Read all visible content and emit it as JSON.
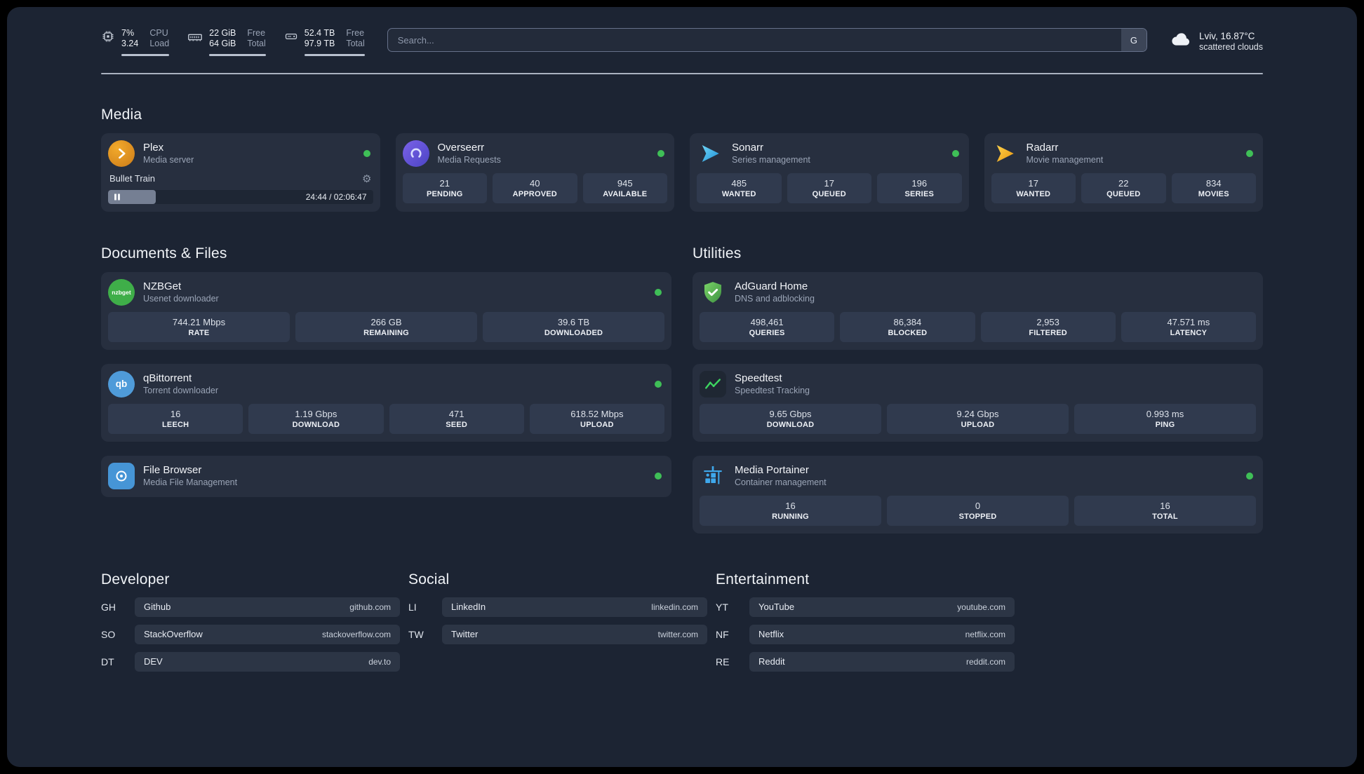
{
  "header": {
    "cpu": {
      "line1": "7%",
      "line2": "3.24",
      "label1": "CPU",
      "label2": "Load"
    },
    "ram": {
      "line1": "22 GiB",
      "line2": "64 GiB",
      "label1": "Free",
      "label2": "Total"
    },
    "disk": {
      "line1": "52.4 TB",
      "line2": "97.9 TB",
      "label1": "Free",
      "label2": "Total"
    },
    "search": {
      "placeholder": "Search...",
      "engine": "G"
    },
    "weather": {
      "location": "Lviv, 16.87°C",
      "condition": "scattered clouds"
    }
  },
  "sections": {
    "media": "Media",
    "documents": "Documents & Files",
    "utilities": "Utilities",
    "developer": "Developer",
    "social": "Social",
    "entertainment": "Entertainment"
  },
  "apps": {
    "plex": {
      "name": "Plex",
      "desc": "Media server",
      "now_playing": "Bullet Train",
      "time": "24:44 / 02:06:47"
    },
    "overseerr": {
      "name": "Overseerr",
      "desc": "Media Requests",
      "stats": [
        {
          "v": "21",
          "l": "PENDING"
        },
        {
          "v": "40",
          "l": "APPROVED"
        },
        {
          "v": "945",
          "l": "AVAILABLE"
        }
      ]
    },
    "sonarr": {
      "name": "Sonarr",
      "desc": "Series management",
      "stats": [
        {
          "v": "485",
          "l": "WANTED"
        },
        {
          "v": "17",
          "l": "QUEUED"
        },
        {
          "v": "196",
          "l": "SERIES"
        }
      ]
    },
    "radarr": {
      "name": "Radarr",
      "desc": "Movie management",
      "stats": [
        {
          "v": "17",
          "l": "WANTED"
        },
        {
          "v": "22",
          "l": "QUEUED"
        },
        {
          "v": "834",
          "l": "MOVIES"
        }
      ]
    },
    "nzbget": {
      "name": "NZBGet",
      "desc": "Usenet downloader",
      "stats": [
        {
          "v": "744.21 Mbps",
          "l": "RATE"
        },
        {
          "v": "266 GB",
          "l": "REMAINING"
        },
        {
          "v": "39.6 TB",
          "l": "DOWNLOADED"
        }
      ]
    },
    "qbittorrent": {
      "name": "qBittorrent",
      "desc": "Torrent downloader",
      "stats": [
        {
          "v": "16",
          "l": "LEECH"
        },
        {
          "v": "1.19 Gbps",
          "l": "DOWNLOAD"
        },
        {
          "v": "471",
          "l": "SEED"
        },
        {
          "v": "618.52 Mbps",
          "l": "UPLOAD"
        }
      ]
    },
    "filebrowser": {
      "name": "File Browser",
      "desc": "Media File Management"
    },
    "adguard": {
      "name": "AdGuard Home",
      "desc": "DNS and adblocking",
      "stats": [
        {
          "v": "498,461",
          "l": "QUERIES"
        },
        {
          "v": "86,384",
          "l": "BLOCKED"
        },
        {
          "v": "2,953",
          "l": "FILTERED"
        },
        {
          "v": "47.571 ms",
          "l": "LATENCY"
        }
      ]
    },
    "speedtest": {
      "name": "Speedtest",
      "desc": "Speedtest Tracking",
      "stats": [
        {
          "v": "9.65 Gbps",
          "l": "DOWNLOAD"
        },
        {
          "v": "9.24 Gbps",
          "l": "UPLOAD"
        },
        {
          "v": "0.993 ms",
          "l": "PING"
        }
      ]
    },
    "portainer": {
      "name": "Media Portainer",
      "desc": "Container management",
      "stats": [
        {
          "v": "16",
          "l": "RUNNING"
        },
        {
          "v": "0",
          "l": "STOPPED"
        },
        {
          "v": "16",
          "l": "TOTAL"
        }
      ]
    }
  },
  "bookmarks": {
    "developer": [
      {
        "abbr": "GH",
        "name": "Github",
        "url": "github.com"
      },
      {
        "abbr": "SO",
        "name": "StackOverflow",
        "url": "stackoverflow.com"
      },
      {
        "abbr": "DT",
        "name": "DEV",
        "url": "dev.to"
      }
    ],
    "social": [
      {
        "abbr": "LI",
        "name": "LinkedIn",
        "url": "linkedin.com"
      },
      {
        "abbr": "TW",
        "name": "Twitter",
        "url": "twitter.com"
      }
    ],
    "entertainment": [
      {
        "abbr": "YT",
        "name": "YouTube",
        "url": "youtube.com"
      },
      {
        "abbr": "NF",
        "name": "Netflix",
        "url": "netflix.com"
      },
      {
        "abbr": "RE",
        "name": "Reddit",
        "url": "reddit.com"
      }
    ]
  },
  "icons": {
    "nzbget": "nzbget",
    "qbittorrent": "qb"
  },
  "colors": {
    "status_online": "#3fbf57",
    "background": "#1c2433",
    "card": "#272f3f",
    "tile": "#303a4e"
  }
}
